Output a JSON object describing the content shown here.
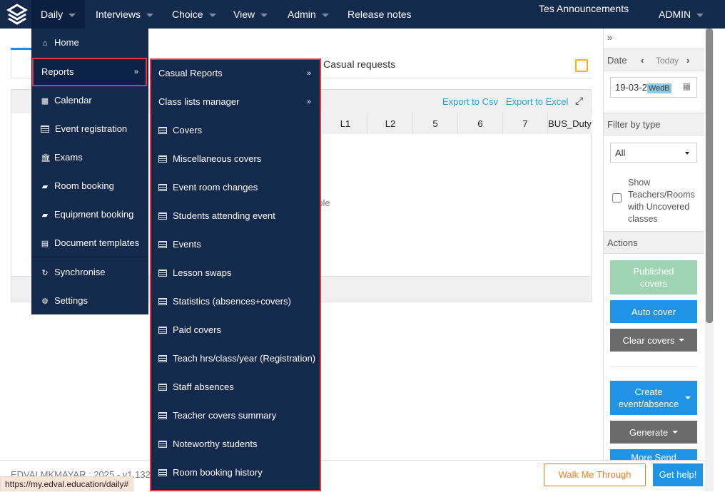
{
  "nav": {
    "items": [
      "Daily",
      "Interviews",
      "Choice",
      "View",
      "Admin",
      "Release notes"
    ],
    "announcements": "Tes Announcements",
    "user": "ADMIN"
  },
  "main": {
    "tab_label": "Casual requests",
    "export_csv": "Export to Csv",
    "export_excel": "Export to Excel",
    "columns": [
      "L1",
      "L2",
      "5",
      "6",
      "7",
      "BUS_Duty"
    ],
    "empty_text": "able"
  },
  "daily_menu": {
    "items": [
      {
        "label": "Home",
        "icon": "home-icon"
      },
      {
        "label": "Reports",
        "icon": ""
      },
      {
        "label": "Calendar",
        "icon": "calendar-icon"
      },
      {
        "label": "Event registration",
        "icon": "list-icon"
      },
      {
        "label": "Exams",
        "icon": "bank-icon"
      },
      {
        "label": "Room booking",
        "icon": "book-icon"
      },
      {
        "label": "Equipment booking",
        "icon": "book-icon"
      },
      {
        "label": "Document templates",
        "icon": "file-icon"
      },
      {
        "label": "Synchronise",
        "icon": "refresh-icon"
      },
      {
        "label": "Settings",
        "icon": "gear-icon"
      }
    ]
  },
  "reports_menu": {
    "items": [
      "Casual Reports",
      "Class lists manager",
      "Covers",
      "Miscellaneous covers",
      "Event room changes",
      "Students attending event",
      "Events",
      "Lesson swaps",
      "Statistics (absences+covers)",
      "Paid covers",
      "Teach hrs/class/year (Registration)",
      "Staff absences",
      "Teacher covers summary",
      "Noteworthy students",
      "Room booking history"
    ]
  },
  "sidebar": {
    "collapse": "»",
    "date_label": "Date",
    "today": "Today",
    "date_value": "19-03-2",
    "day_badge": "WedB",
    "filter_label": "Filter by type",
    "filter_value": "All",
    "checkbox_label": "Show Teachers/Rooms with Uncovered classes",
    "actions_label": "Actions",
    "published": "Published covers",
    "auto_cover": "Auto cover",
    "clear_covers": "Clear covers",
    "create": "Create event/absence",
    "generate": "Generate",
    "more": "More Send"
  },
  "footer": {
    "version": "EDVALMKMAYAR : 2025 - v1.132",
    "walk": "Walk Me Through",
    "help": "Get help!",
    "status_url": "https://my.edval.education/daily#"
  },
  "colors": {
    "nav": "#142a4c",
    "accent": "#1f93e6",
    "highlight": "#e8363d",
    "published": "#9fd4b3",
    "grey_btn": "#6b6b6b"
  }
}
